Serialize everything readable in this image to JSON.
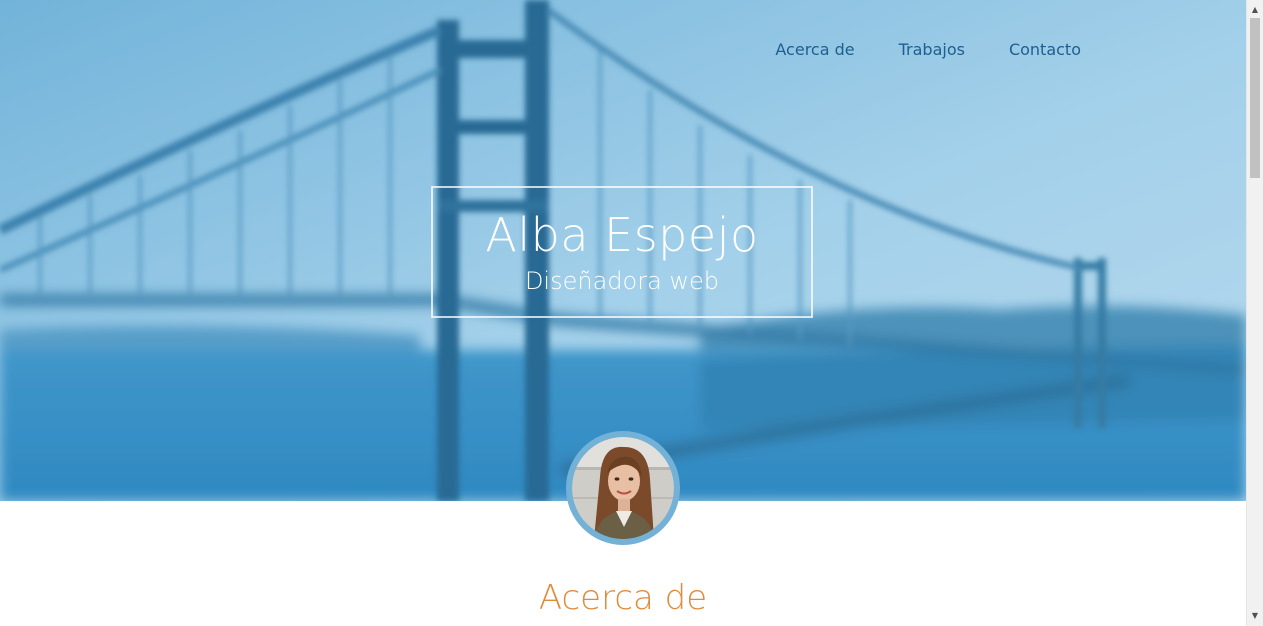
{
  "nav": {
    "items": [
      {
        "label": "Acerca de"
      },
      {
        "label": "Trabajos"
      },
      {
        "label": "Contacto"
      }
    ]
  },
  "hero": {
    "name": "Alba Espejo",
    "role": "Diseñadora web",
    "background_image": "blurred-golden-gate-bridge-photo"
  },
  "profile": {
    "avatar": "profile-photo-of-woman"
  },
  "sections": {
    "about_title": "Acerca de"
  },
  "colors": {
    "nav_link": "#1d5f8f",
    "hero_text": "#ffffff",
    "section_title": "#e08a3c",
    "avatar_ring": "#74b1d6"
  }
}
